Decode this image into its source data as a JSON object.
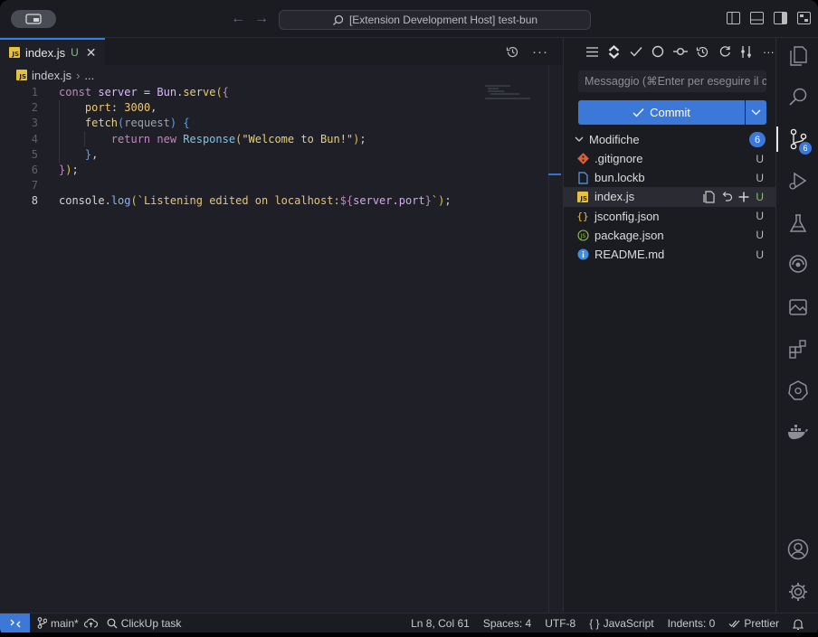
{
  "titlebar": {
    "search_text": "[Extension Development Host] test-bun"
  },
  "editor": {
    "tab": {
      "label": "index.js",
      "status": "U"
    },
    "breadcrumb": {
      "file": "index.js",
      "ellipsis": "..."
    },
    "line_numbers": [
      "1",
      "2",
      "3",
      "4",
      "5",
      "6",
      "7",
      "8"
    ],
    "code": {
      "l1": {
        "kw": "const",
        "var": " server",
        "eq": " = ",
        "obj": "Bun",
        "dot": ".",
        "fn": "serve",
        "p1": "(",
        "p2": "{"
      },
      "l2": {
        "prop": "port",
        "colon": ": ",
        "num": "3000",
        "comma": ","
      },
      "l3": {
        "fn": "fetch",
        "p1": "(",
        "arg": "request",
        "p2": ")",
        "sp": " ",
        "p3": "{"
      },
      "l4": {
        "kw": "return",
        "kw2": " new",
        "cls": " Response",
        "p1": "(",
        "str": "\"Welcome to Bun!\"",
        "p2": ")",
        "semi": ";"
      },
      "l5": {
        "p": "}",
        "comma": ","
      },
      "l6": {
        "p1": "}",
        "p2": ")",
        "semi": ";"
      },
      "l8": {
        "obj": "console",
        "dot": ".",
        "fn": "log",
        "p1": "(",
        "tmpl1": "`Listening edited on localhost:",
        "tv1": "${",
        "tvar": "server",
        "tdot": ".",
        "tprop": "port",
        "tv2": "}",
        "tmpl2": "`",
        "p2": ")",
        "semi": ";"
      }
    }
  },
  "scm": {
    "message_placeholder": "Messaggio (⌘Enter per eseguire il commit su 'main')",
    "commit_label": "Commit",
    "changes_label": "Modifiche",
    "changes_count": "6",
    "files": [
      {
        "name": ".gitignore",
        "status": "U",
        "icon": "git-icon"
      },
      {
        "name": "bun.lockb",
        "status": "U",
        "icon": "file-icon"
      },
      {
        "name": "index.js",
        "status": "U",
        "icon": "js-icon"
      },
      {
        "name": "jsconfig.json",
        "status": "U",
        "icon": "json-icon"
      },
      {
        "name": "package.json",
        "status": "U",
        "icon": "npm-icon"
      },
      {
        "name": "README.md",
        "status": "U",
        "icon": "info-icon"
      }
    ]
  },
  "activity": {
    "scm_badge": "6"
  },
  "statusbar": {
    "branch": "main*",
    "clickup": "ClickUp task",
    "position": "Ln 8, Col 61",
    "spaces": "Spaces: 4",
    "encoding": "UTF-8",
    "language_prefix": "{ }",
    "language": "JavaScript",
    "indents": "Indents: 0",
    "prettier": "Prettier"
  },
  "colors": {
    "accent": "#3b78d8",
    "untracked": "#7ec16e"
  }
}
